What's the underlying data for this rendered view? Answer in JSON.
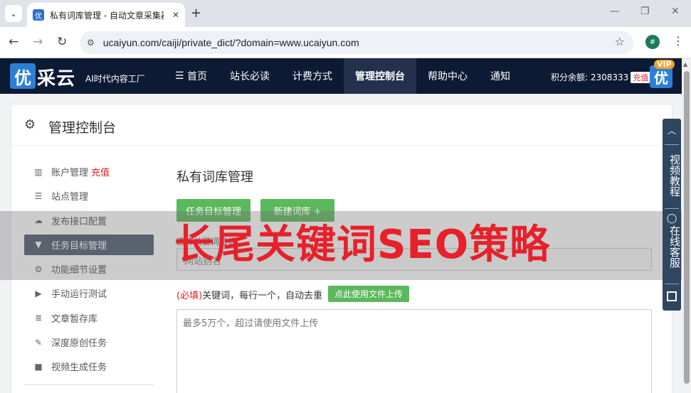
{
  "browser": {
    "tab_title": "私有词库管理 - 自动文章采集器",
    "tab_favicon": "优",
    "url": "ucaiyun.com/caiji/private_dict/?domain=www.ucaiyun.com",
    "profile_initial": "#"
  },
  "site": {
    "logo_char": "优",
    "logo_text": "采云",
    "slogan": "AI时代内容工厂",
    "nav": [
      "首页",
      "站长必读",
      "计费方式",
      "管理控制台",
      "帮助中心",
      "通知"
    ],
    "nav_active_index": 3,
    "credits": "积分余额: 2308333",
    "recharge": "充值",
    "vip": "VIP",
    "avatar_char": "优"
  },
  "panel": {
    "title": "管理控制台",
    "sidebar": [
      {
        "label": "账户管理",
        "badge": "充值",
        "icon": "bar-chart-icon"
      },
      {
        "label": "站点管理",
        "icon": "server-icon"
      },
      {
        "label": "发布接口配置",
        "icon": "cloud-upload-icon"
      },
      {
        "label": "任务目标管理",
        "icon": "filter-icon",
        "active": true
      },
      {
        "label": "功能细节设置",
        "icon": "gears-icon"
      },
      {
        "label": "手动运行测试",
        "icon": "play-icon"
      },
      {
        "label": "文章暂存库",
        "icon": "database-icon"
      },
      {
        "label": "深度原创任务",
        "icon": "edit-icon"
      },
      {
        "label": "视频生成任务",
        "icon": "video-icon"
      }
    ],
    "section_title": "私有词库管理",
    "btn_task_target": "任务目标管理",
    "btn_new_dict": "新建词库 +",
    "target_label": "选择关键词目标:",
    "target_placeholder": "网站别名",
    "kw_required": "(必填)",
    "kw_label": "关键词，每行一个，自动去重",
    "upload_btn": "点此使用文件上传",
    "kw_placeholder": "最多5万个，超过请使用文件上传"
  },
  "overlay": {
    "text": "长尾关键词SEO策略"
  },
  "float_tools": {
    "video": "视频教程",
    "service": "在线客服"
  }
}
